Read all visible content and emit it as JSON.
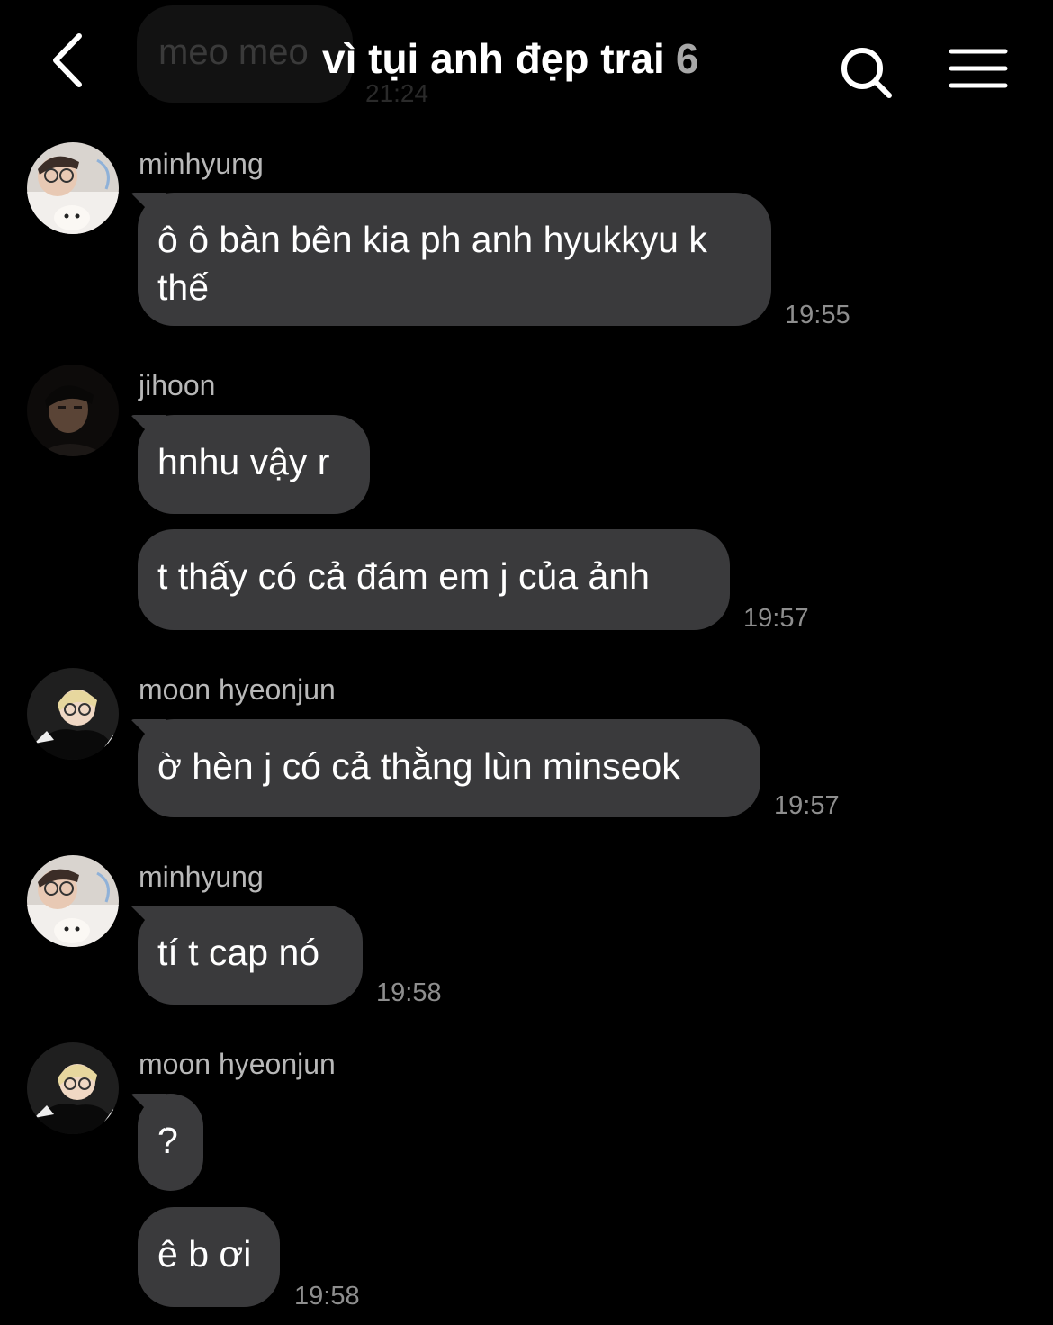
{
  "header": {
    "ghost_message": "meo meo",
    "ghost_time": "21:24",
    "title": "vì tụi anh đẹp trai",
    "member_count": "6",
    "icons": [
      "back-icon",
      "search-icon",
      "menu-icon"
    ]
  },
  "messages": [
    {
      "sender": "minhyung",
      "text": "ô ô bàn bên kia ph anh hyukkyu k thế",
      "time": "19:55"
    },
    {
      "sender": "jihoon",
      "text": "hnhu vậy r"
    },
    {
      "text": "t thấy có cả đám em j của ảnh",
      "time": "19:57"
    },
    {
      "sender": "moon hyeonjun",
      "text": "ờ hèn j có cả thằng lùn minseok",
      "time": "19:57"
    },
    {
      "sender": "minhyung",
      "text": "tí t cap nó",
      "time": "19:58"
    },
    {
      "sender": "moon hyeonjun",
      "text": "?"
    },
    {
      "text": "ê b ơi",
      "time": "19:58"
    }
  ],
  "colors": {
    "background": "#000000",
    "bubble": "#3a3a3c",
    "sender_text": "#b8b8b8",
    "time_text": "#8e8e8e"
  }
}
